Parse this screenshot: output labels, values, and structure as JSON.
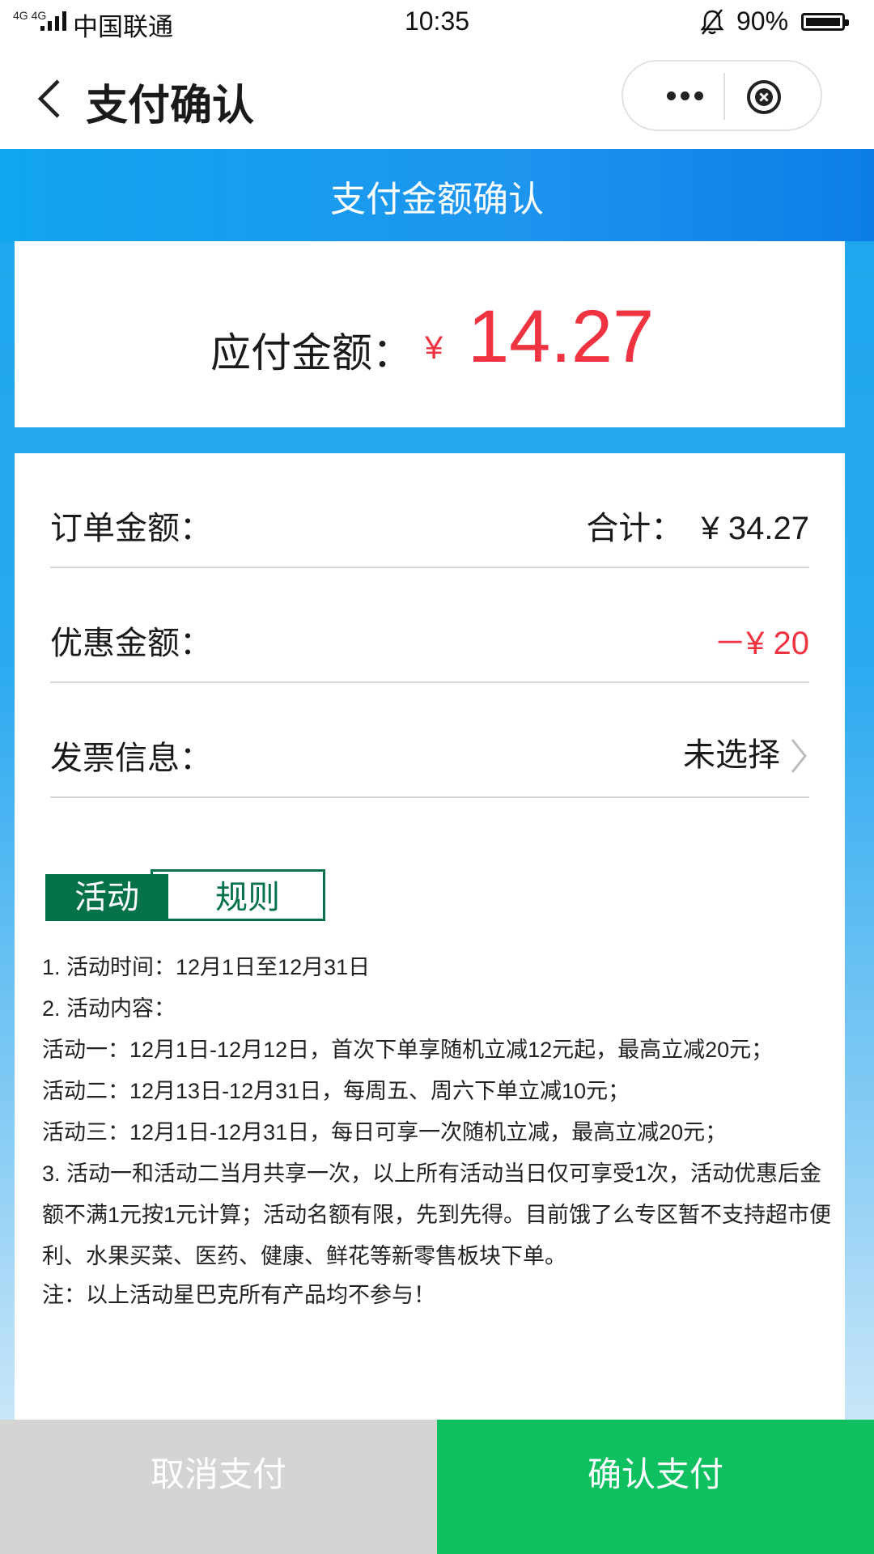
{
  "status_bar": {
    "network": "4G 4G",
    "carrier": "中国联通",
    "time": "10:35",
    "battery": "90%"
  },
  "nav": {
    "title": "支付确认"
  },
  "banner": {
    "title": "支付金额确认"
  },
  "amount": {
    "label": "应付金额：",
    "currency": "¥",
    "value": "14.27"
  },
  "details": [
    {
      "label": "订单金额：",
      "value": "合计：  ¥ 34.27"
    },
    {
      "label": "优惠金额：",
      "value": "－¥ 20"
    },
    {
      "label": "发票信息：",
      "value": "未选择"
    }
  ],
  "tabs": {
    "active": "活动",
    "rule": "规则"
  },
  "rules": [
    "1. 活动时间：12月1日至12月31日",
    "2. 活动内容：",
    "活动一：12月1日-12月12日，首次下单享随机立减12元起，最高立减20元；",
    "活动二：12月13日-12月31日，每周五、周六下单立减10元；",
    "活动三：12月1日-12月31日，每日可享一次随机立减，最高立减20元；",
    "3. 活动一和活动二当月共享一次，以上所有活动当日仅可享受1次，活动优惠后金额不满1元按1元计算；活动名额有限，先到先得。目前饿了么专区暂不支持超市便利、水果买菜、医药、健康、鲜花等新零售板块下单。",
    "注：以上活动星巴克所有产品均不参与！"
  ],
  "buttons": {
    "cancel": "取消支付",
    "confirm": "确认支付"
  },
  "colors": {
    "accent_blue": "#1ca6ee",
    "price_red": "#ef3340",
    "tab_green": "#06724a",
    "confirm_green": "#0ec060",
    "cancel_gray": "#d4d4d4"
  }
}
